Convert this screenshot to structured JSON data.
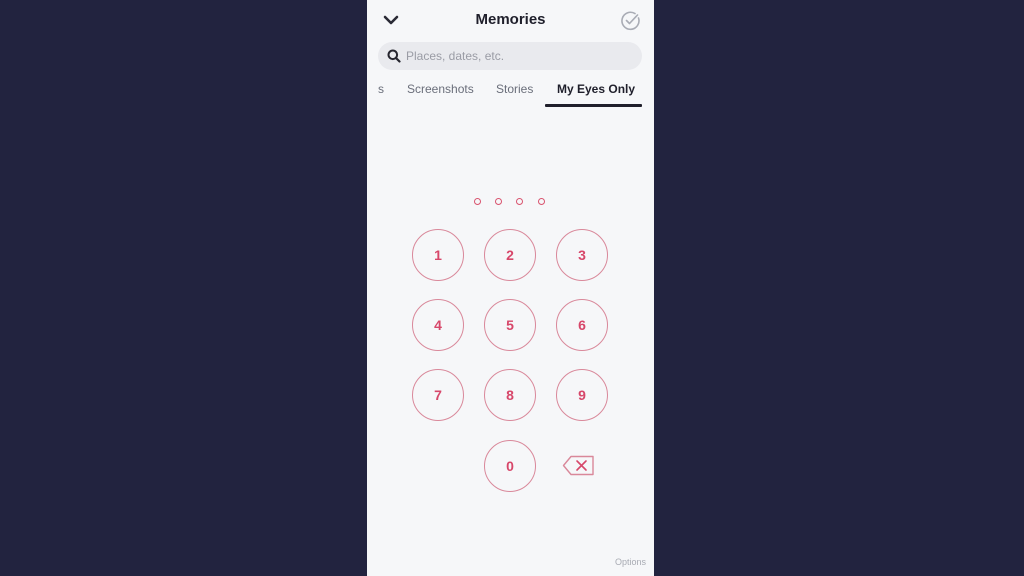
{
  "header": {
    "title": "Memories",
    "back_icon": "chevron-down-icon",
    "select_icon": "check-circle-icon"
  },
  "search": {
    "placeholder": "Places, dates, etc.",
    "value": "",
    "icon": "search-icon"
  },
  "tabs": [
    {
      "label": "s",
      "active": false
    },
    {
      "label": "Screenshots",
      "active": false
    },
    {
      "label": "Stories",
      "active": false
    },
    {
      "label": "My Eyes Only",
      "active": true
    }
  ],
  "passcode": {
    "length": 4,
    "entered": 0,
    "keys": [
      "1",
      "2",
      "3",
      "4",
      "5",
      "6",
      "7",
      "8",
      "9",
      "0"
    ],
    "delete_icon": "backspace-icon"
  },
  "footer": {
    "options_label": "Options"
  },
  "colors": {
    "accent": "#d7476a",
    "background": "#22233f",
    "panel": "#f6f7f9"
  }
}
